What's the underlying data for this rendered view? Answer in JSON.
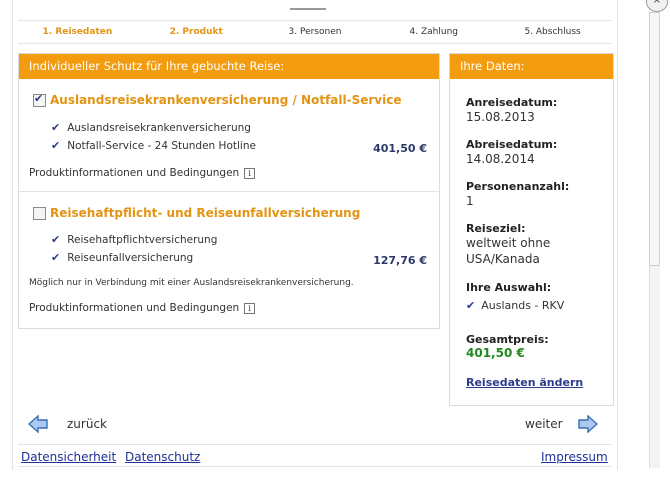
{
  "steps": [
    {
      "label": "1. Reisedaten"
    },
    {
      "label": "2. Produkt"
    },
    {
      "label": "3. Personen"
    },
    {
      "label": "4. Zahlung"
    },
    {
      "label": "5. Abschluss"
    }
  ],
  "left_panel": {
    "header": "Individueller Schutz für Ihre gebuchte Reise:",
    "products": [
      {
        "title": "Auslandsreisekrankenversicherung / Notfall-Service",
        "checked": true,
        "features": [
          "Auslandsreisekrankenversicherung",
          "Notfall-Service - 24 Stunden Hotline"
        ],
        "price": "401,50 €",
        "info_link": "Produktinformationen und Bedingungen"
      },
      {
        "title": "Reisehaftpflicht- und Reiseunfallversicherung",
        "checked": false,
        "features": [
          "Reisehaftpflichtversicherung",
          "Reiseunfallversicherung"
        ],
        "price": "127,76 €",
        "note": "Möglich nur in Verbindung mit einer Auslandsreisekrankenversicherung.",
        "info_link": "Produktinformationen und Bedingungen"
      }
    ]
  },
  "right_panel": {
    "header": "Ihre Daten:",
    "anreise_label": "Anreisedatum:",
    "anreise_value": "15.08.2013",
    "abreise_label": "Abreisedatum:",
    "abreise_value": "14.08.2014",
    "personen_label": "Personenanzahl:",
    "personen_value": "1",
    "reiseziel_label": "Reiseziel:",
    "reiseziel_value_1": "weltweit ohne",
    "reiseziel_value_2": "USA/Kanada",
    "auswahl_label": "Ihre Auswahl:",
    "auswahl_value": "Auslands - RKV",
    "gesamt_label": "Gesamtpreis:",
    "gesamt_value": "401,50 €",
    "edit_link": "Reisedaten ändern"
  },
  "nav": {
    "back": "zurück",
    "next": "weiter"
  },
  "footer": {
    "link1": "Datensicherheit",
    "link2": "Datenschutz",
    "link3": "Impressum"
  },
  "colors": {
    "accent": "#f39c10",
    "link": "#2c3c8c",
    "price_green": "#22891f"
  }
}
